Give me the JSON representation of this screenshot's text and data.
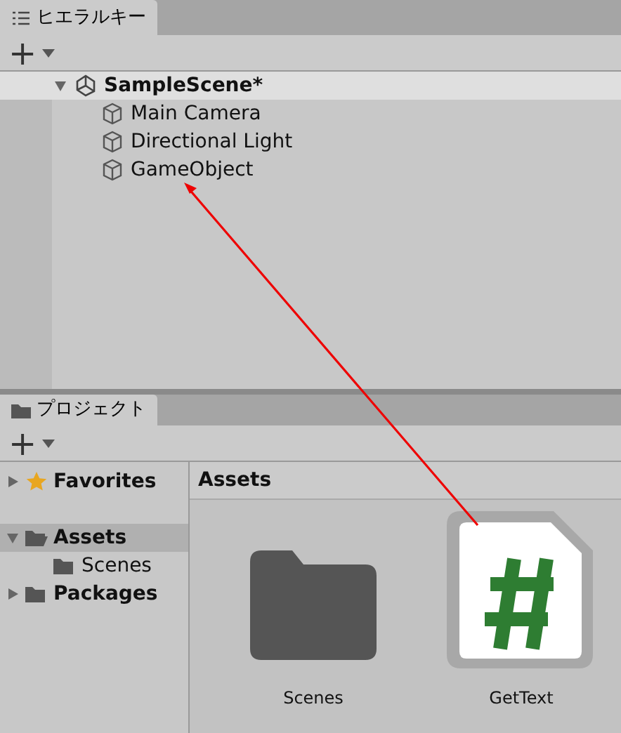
{
  "hierarchy": {
    "tab": {
      "label": "ヒエラルキー",
      "selected": true
    },
    "add_button": "+",
    "scene": {
      "label": "SampleScene*",
      "expanded": true,
      "children": [
        {
          "label": "Main Camera"
        },
        {
          "label": "Directional Light"
        },
        {
          "label": "GameObject"
        }
      ]
    }
  },
  "project": {
    "tab": {
      "label": "プロジェクト",
      "selected": true
    },
    "add_button": "+",
    "sidebar": [
      {
        "label": "Favorites",
        "kind": "favorites",
        "expanded": false,
        "selected": false
      },
      {
        "label": "Assets",
        "kind": "folder",
        "expanded": true,
        "selected": true,
        "children": [
          {
            "label": "Scenes",
            "kind": "folder",
            "selected": false
          }
        ]
      },
      {
        "label": "Packages",
        "kind": "folder",
        "expanded": false,
        "selected": false
      }
    ],
    "breadcrumb": "Assets",
    "assets": [
      {
        "label": "Scenes",
        "kind": "folder"
      },
      {
        "label": "GetText",
        "kind": "script"
      }
    ]
  }
}
